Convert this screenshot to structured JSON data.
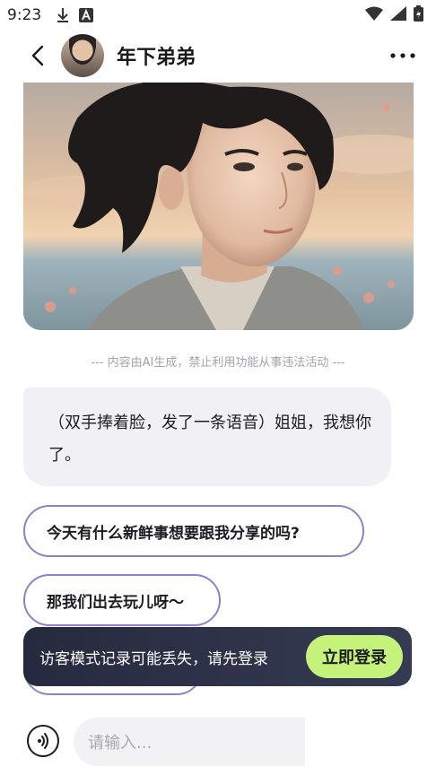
{
  "status_bar": {
    "time": "9:23",
    "icons": [
      "download-icon",
      "a-badge-icon",
      "wifi-icon",
      "signal-icon",
      "battery-icon"
    ]
  },
  "header": {
    "title": "年下弟弟",
    "back_icon": "chevron-left-icon",
    "more_icon": "more-horizontal-icon"
  },
  "disclaimer": "--- 内容由AI生成，禁止利用功能从事违法活动 ---",
  "chat": {
    "ai_message": "（双手捧着脸，发了一条语音）姐姐，我想你了。",
    "suggestions": [
      "今天有什么新鲜事想要跟我分享的吗?",
      "那我们出去玩儿呀～",
      ""
    ]
  },
  "toast": {
    "text": "访客模式记录可能丢失，请先登录",
    "button": "立即登录"
  },
  "input": {
    "placeholder": "请输入...",
    "mic_icon": "voice-wave-icon"
  },
  "colors": {
    "accent_border": "#8c82c6",
    "login_button": "#c5f27a",
    "toast_bg": "#262a3f",
    "bubble_bg": "#f1f1f5"
  }
}
